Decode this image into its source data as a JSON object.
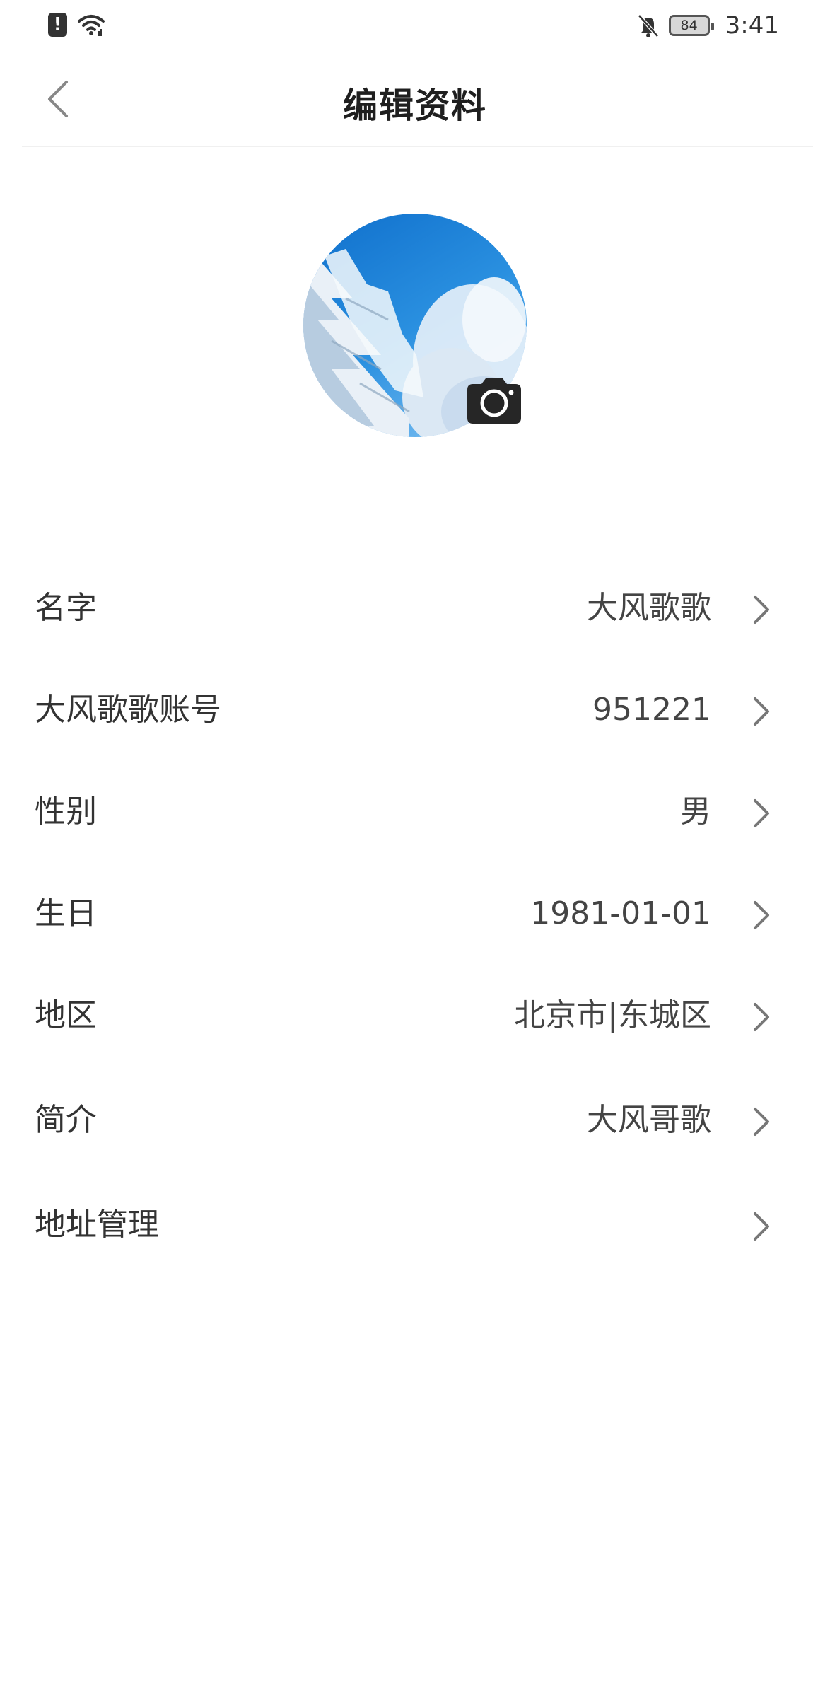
{
  "status_bar": {
    "battery": "84",
    "time": "3:41"
  },
  "header": {
    "title": "编辑资料"
  },
  "profile_rows": [
    {
      "label": "名字",
      "value": "大风歌歌"
    },
    {
      "label": "大风歌歌账号",
      "value": "951221"
    },
    {
      "label": "性别",
      "value": "男"
    },
    {
      "label": "生日",
      "value": "1981-01-01"
    },
    {
      "label": "地区",
      "value": "北京市|东城区"
    },
    {
      "label": "简介",
      "value": "大风哥歌"
    },
    {
      "label": "地址管理",
      "value": ""
    }
  ],
  "colors": {
    "sky_blue": "#1f86d6",
    "text_primary": "#333333"
  }
}
